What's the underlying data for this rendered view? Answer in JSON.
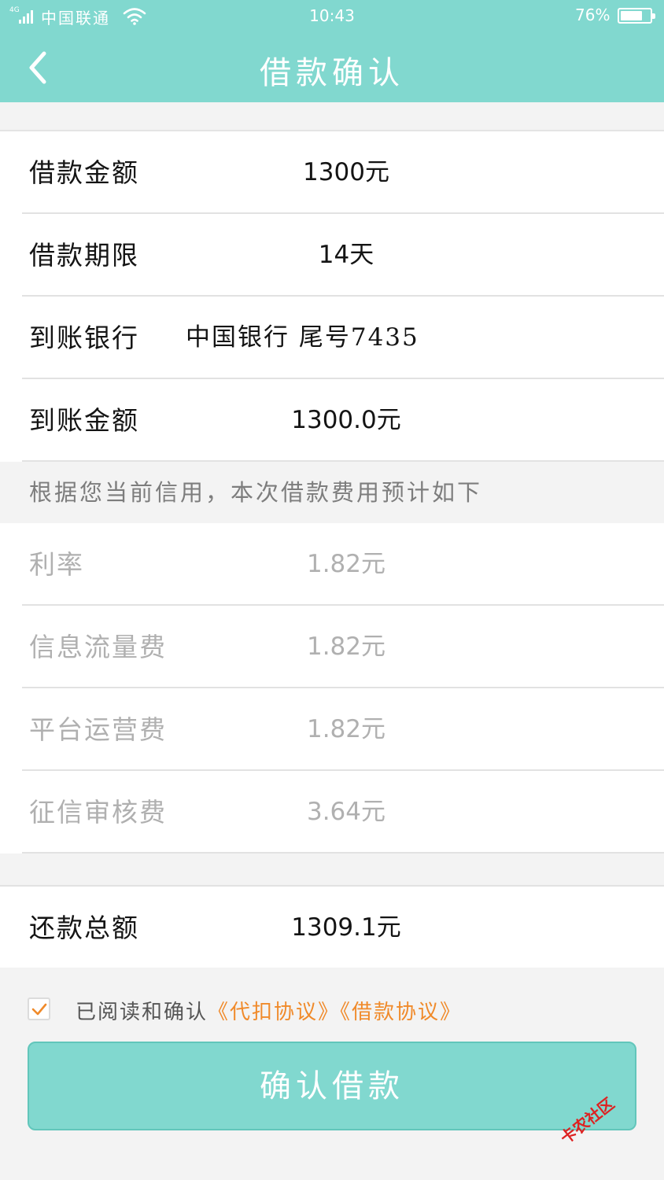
{
  "status_bar": {
    "network": "4G",
    "carrier": "中国联通",
    "time": "10:43",
    "battery_percent": "76%",
    "battery_level": 0.76
  },
  "header": {
    "title": "借款确认",
    "back_icon": "chevron-left-icon"
  },
  "loan_details": [
    {
      "label": "借款金额",
      "value": "1300元"
    },
    {
      "label": "借款期限",
      "value": "14天"
    },
    {
      "label": "到账银行",
      "value": "中国银行  尾号7435"
    },
    {
      "label": "到账金额",
      "value": "1300.0元"
    }
  ],
  "fee_notice": "根据您当前信用，本次借款费用预计如下",
  "fees": [
    {
      "label": "利率",
      "value": "1.82元"
    },
    {
      "label": "信息流量费",
      "value": "1.82元"
    },
    {
      "label": "平台运营费",
      "value": "1.82元"
    },
    {
      "label": "征信审核费",
      "value": "3.64元"
    }
  ],
  "total": {
    "label": "还款总额",
    "value": "1309.1元"
  },
  "agreement": {
    "checked": true,
    "prefix": "已阅读和确认",
    "link1": "《代扣协议》",
    "link2": "《借款协议》"
  },
  "confirm_button": "确认借款",
  "watermark": "卡农社区",
  "colors": {
    "primary": "#81d8cf",
    "link": "#f08a2a",
    "muted_text": "#b0b0b0",
    "background": "#f3f3f3"
  }
}
